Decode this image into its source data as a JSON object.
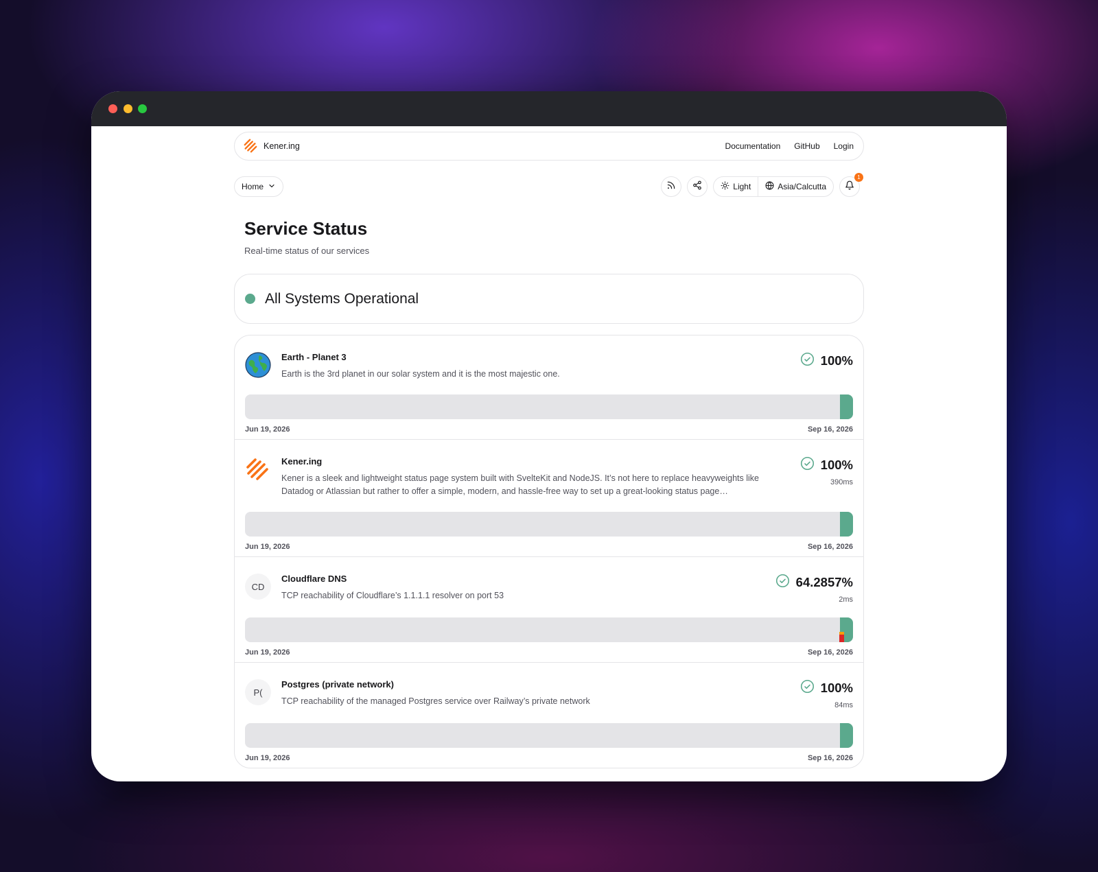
{
  "nav": {
    "brand": "Kener.ing",
    "links": [
      "Documentation",
      "GitHub",
      "Login"
    ]
  },
  "toolbar": {
    "home_label": "Home",
    "theme_label": "Light",
    "timezone_label": "Asia/Calcutta",
    "notification_count": "1"
  },
  "page": {
    "title": "Service Status",
    "subtitle": "Real-time status of our services"
  },
  "status": {
    "text": "All Systems Operational",
    "color": "#5ba98d"
  },
  "monitors": [
    {
      "name": "Earth - Planet 3",
      "description": "Earth is the 3rd planet in our solar system and it is the most majestic one.",
      "icon": "earth-icon",
      "uptime": "100%",
      "latency": "",
      "start_date": "Jun 19, 2026",
      "end_date": "Sep 16, 2026"
    },
    {
      "name": "Kener.ing",
      "description": "Kener is a sleek and lightweight status page system built with SvelteKit and NodeJS. It’s not here to replace heavyweights like Datadog or Atlassian but rather to offer a simple, modern, and hassle-free way to set up a great-looking status page…",
      "icon": "kener-logo-icon",
      "uptime": "100%",
      "latency": "390ms",
      "start_date": "Jun 19, 2026",
      "end_date": "Sep 16, 2026"
    },
    {
      "name": "Cloudflare DNS",
      "description": "TCP reachability of Cloudflare’s 1.1.1.1 resolver on port 53",
      "icon_initials": "CD",
      "uptime": "64.2857%",
      "latency": "2ms",
      "start_date": "Jun 19, 2026",
      "end_date": "Sep 16, 2026"
    },
    {
      "name": "Postgres (private network)",
      "description": "TCP reachability of the managed Postgres service over Railway’s private network",
      "icon_initials": "P(",
      "uptime": "100%",
      "latency": "84ms",
      "start_date": "Jun 19, 2026",
      "end_date": "Sep 16, 2026"
    }
  ],
  "colors": {
    "up": "#5ba98d",
    "down": "#dc2626",
    "degraded": "#f59e0b",
    "brand": "#f97316"
  }
}
